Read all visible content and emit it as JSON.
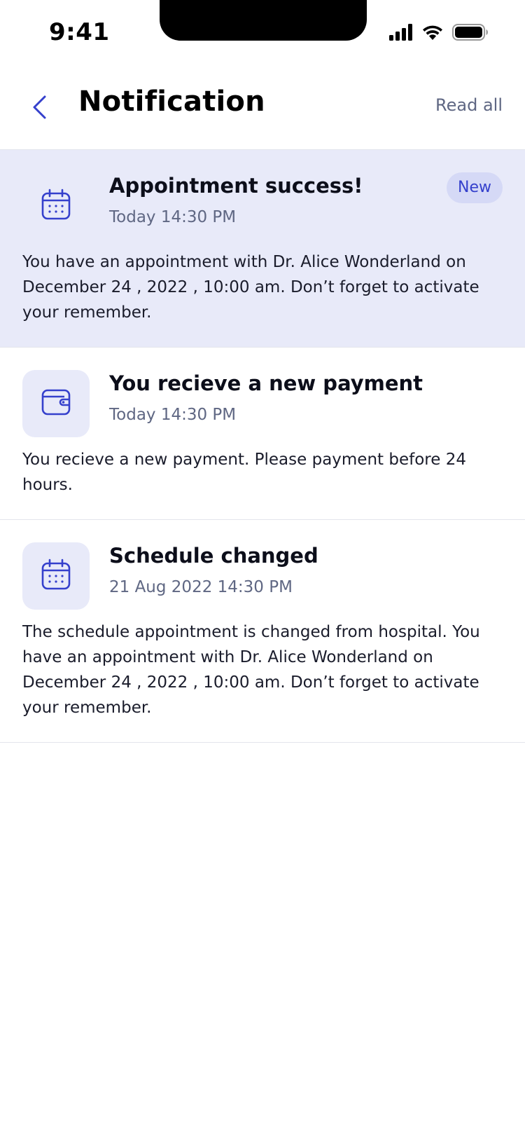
{
  "status_bar": {
    "time": "9:41"
  },
  "header": {
    "title": "Notification",
    "read_all_label": "Read all",
    "back_icon": "chevron-left-icon"
  },
  "colors": {
    "accent": "#3540CC",
    "unread_bg": "#E8EAF9",
    "badge_bg": "#D5D9F6",
    "muted_text": "#5F6783",
    "divider": "#E3E5EC"
  },
  "notifications": [
    {
      "icon": "calendar-icon",
      "title": "Appointment success!",
      "time": "Today 14:30 PM",
      "badge": "New",
      "body": "You have an appointment with Dr. Alice Wonderland on December 24 , 2022 , 10:00 am. Don’t forget to activate your remember."
    },
    {
      "icon": "wallet-icon",
      "title": "You recieve a new payment",
      "time": "Today 14:30 PM",
      "body": "You recieve a new payment. Please payment before 24 hours."
    },
    {
      "icon": "calendar-icon",
      "title": "Schedule changed",
      "time": "21 Aug 2022  14:30 PM",
      "body": "The schedule appointment is changed from hospital. You have an appointment with Dr. Alice Wonderland on December 24 , 2022 , 10:00 am. Don’t forget to activate your remember."
    }
  ]
}
